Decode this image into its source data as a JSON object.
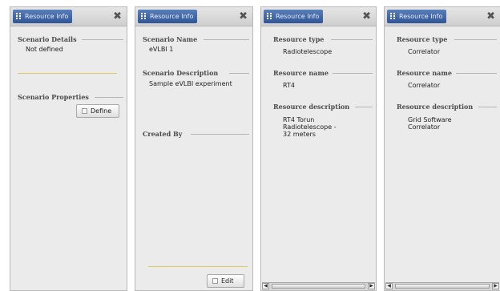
{
  "window_title": "Resource Info",
  "close_glyph": "✖",
  "panels": {
    "scenario_summary": {
      "title": "Resource Info",
      "details_label": "Scenario Details",
      "details_value": "Not defined",
      "properties_label": "Scenario Properties",
      "define_button": "Define"
    },
    "scenario_detail": {
      "title": "Resource Info",
      "name_label": "Scenario Name",
      "name_value": "eVLBI 1",
      "description_label": "Scenario Description",
      "description_value": "Sample eVLBI experiment",
      "created_by_label": "Created By",
      "edit_button": "Edit"
    },
    "resource_rt4": {
      "title": "Resource Info",
      "type_label": "Resource type",
      "type_value": "Radiotelescope",
      "name_label": "Resource name",
      "name_value": "RT4",
      "description_label": "Resource description",
      "description_lines": [
        "RT4 Torun",
        "Radiotelescope -",
        "32 meters"
      ]
    },
    "resource_correlator": {
      "title": "Resource Info",
      "type_label": "Resource type",
      "type_value": "Correlator",
      "name_label": "Resource name",
      "name_value": "Correlator",
      "description_label": "Resource description",
      "description_lines": [
        "Grid Software",
        "Correlator"
      ]
    }
  },
  "colors": {
    "tab_blue": "#2f5597",
    "panel_bg": "#ebebeb",
    "separator_yellow": "#e0c860"
  },
  "icons": {
    "tab": "grid-dots-icon",
    "close": "close-x-icon",
    "button": "button-doc-icon"
  }
}
